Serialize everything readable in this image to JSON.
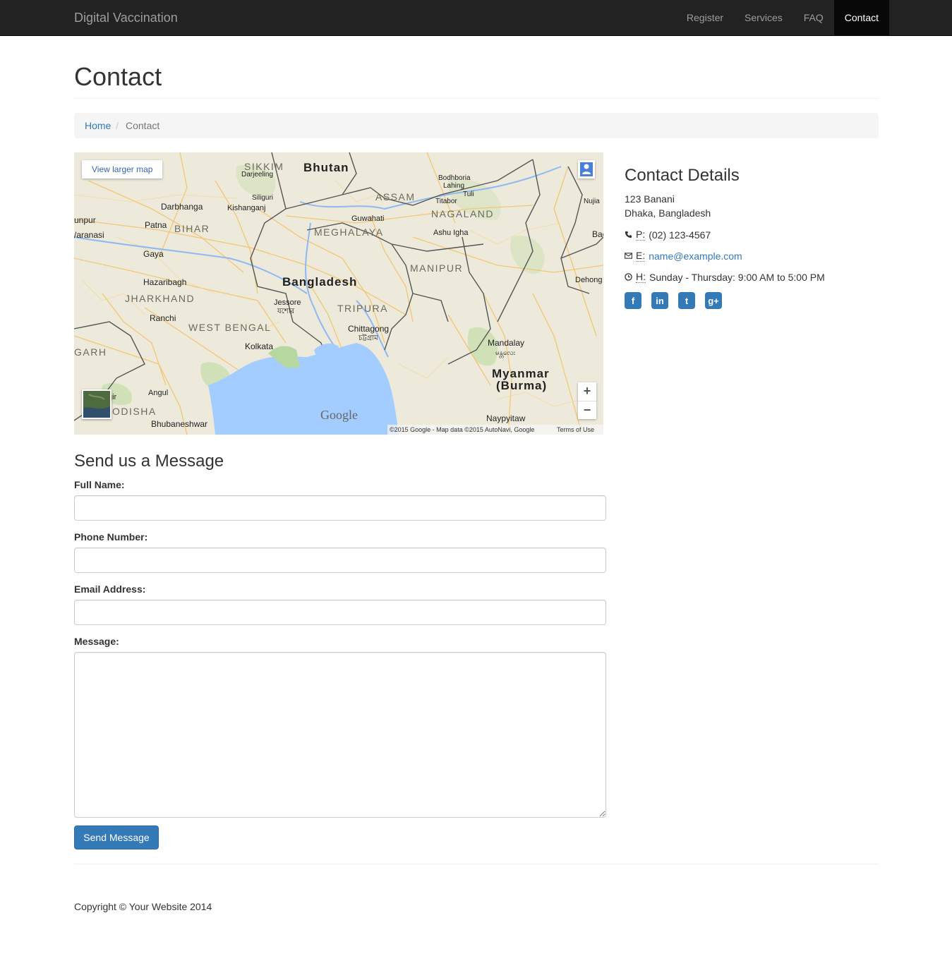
{
  "navbar": {
    "brand": "Digital Vaccination",
    "links": [
      {
        "label": "Register"
      },
      {
        "label": "Services"
      },
      {
        "label": "FAQ"
      },
      {
        "label": "Contact",
        "active": true
      }
    ]
  },
  "page": {
    "title": "Contact"
  },
  "breadcrumb": {
    "home": "Home",
    "separator": "/",
    "current": "Contact"
  },
  "map": {
    "view_larger": "View larger map",
    "google_logo": "Google",
    "attribution": "©2015 Google - Map data ©2015 AutoNavi, Google",
    "terms": "Terms of Use",
    "zoom_in": "+",
    "zoom_out": "−",
    "labels": {
      "sikkim": "SIKKIM",
      "bhutan": "Bhutan",
      "darjeeling": "Darjeeling",
      "bodhbaria": "Bodhboria",
      "lahing": "Lahing",
      "assam": "ASSAM",
      "tuli": "Tuli",
      "nujiang": "Nujia",
      "siliguri": "Siliguri",
      "darbhanga": "Darbhanga",
      "kishanganj": "Kishanganj",
      "guwahati": "Guwahati",
      "titabor": "Titabor",
      "nagaland": "NAGALAND",
      "jaunpur": "unpur",
      "patna": "Patna",
      "bihar": "BIHAR",
      "meghalaya": "MEGHALAYA",
      "ashu_igha": "Ashu Igha",
      "varanasi": "/aranasi",
      "bac": "Bac",
      "gaya": "Gaya",
      "manipur": "MANIPUR",
      "hazaribagh": "Hazaribagh",
      "bangladesh": "Bangladesh",
      "dehong": "Dehong",
      "jharkhand": "JHARKHAND",
      "jessore": "Jessore",
      "jessore_bn": "যশোর",
      "tripura": "TRIPURA",
      "ranchi": "Ranchi",
      "west_bengal": "WEST BENGAL",
      "chittagong": "Chittagong",
      "chittagong_bn": "চট্টগ্রাম",
      "garh": "GARH",
      "kolkata": "Kolkata",
      "mandalay": "Mandalay",
      "mandalay_my": "မန္တလေး",
      "myanmar": "Myanmar",
      "burma": "(Burma)",
      "angul": "Angul",
      "gir": "gir",
      "odisha": "ODISHA",
      "bhubaneshwar": "Bhubaneshwar",
      "naypyitaw": "Naypyitaw"
    }
  },
  "contact_details": {
    "heading": "Contact Details",
    "address_line1": "123 Banani",
    "address_line2": "Dhaka, Bangladesh",
    "phone_abbr": "P:",
    "phone": "(02) 123-4567",
    "email_abbr": "E:",
    "email": "name@example.com",
    "hours_abbr": "H:",
    "hours": "Sunday - Thursday: 9:00 AM to 5:00 PM",
    "social": [
      {
        "icon": "facebook-icon",
        "glyph": "f"
      },
      {
        "icon": "linkedin-icon",
        "glyph": "in"
      },
      {
        "icon": "twitter-icon",
        "glyph": "t"
      },
      {
        "icon": "google-plus-icon",
        "glyph": "g+"
      }
    ]
  },
  "form": {
    "heading": "Send us a Message",
    "full_name_label": "Full Name:",
    "full_name_value": "",
    "phone_label": "Phone Number:",
    "phone_value": "",
    "email_label": "Email Address:",
    "email_value": "",
    "message_label": "Message:",
    "message_value": "",
    "submit_label": "Send Message"
  },
  "footer": {
    "copyright": "Copyright © Your Website 2014"
  },
  "colors": {
    "navbar_bg": "#222222",
    "link": "#337ab7",
    "primary_button": "#337ab7",
    "water": "#a3ccff"
  }
}
